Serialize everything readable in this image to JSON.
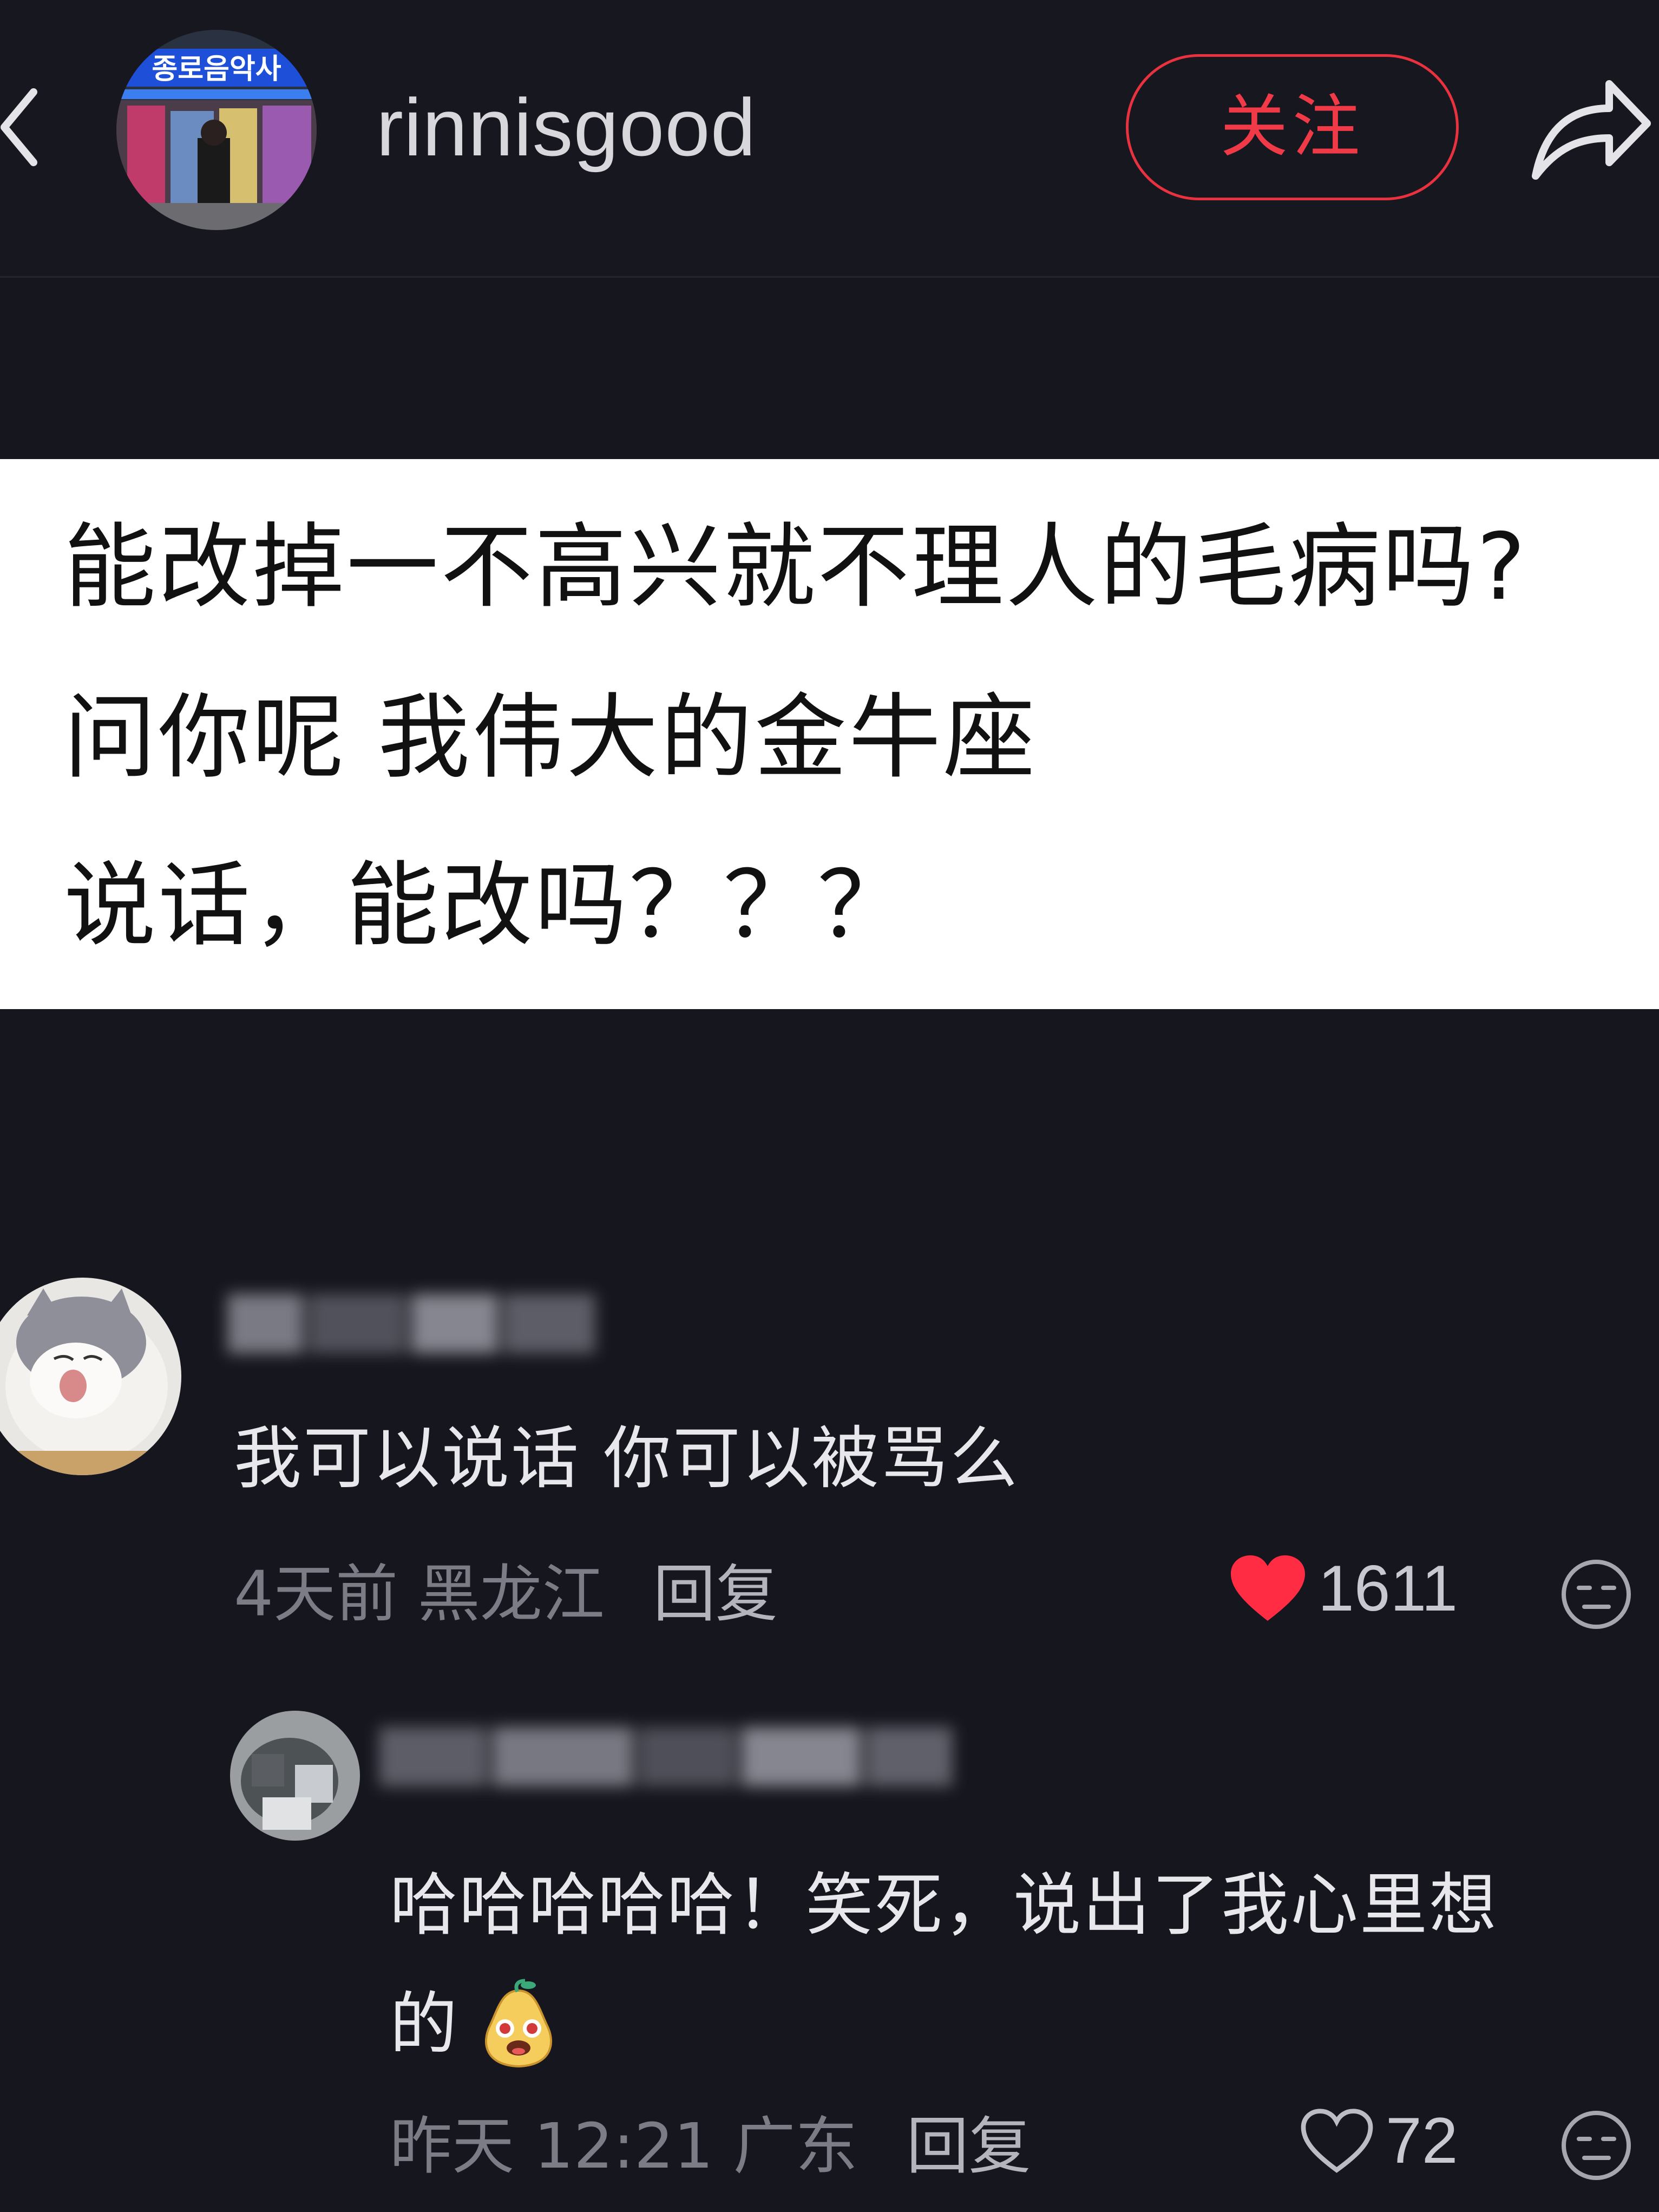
{
  "header": {
    "username": "rinnisgood",
    "follow_label": "关注",
    "avatar_sign_text": "종로음악사"
  },
  "post": {
    "lines": [
      "能改掉一不高兴就不理人的毛病吗?",
      "问你呢 我伟大的金牛座",
      "说话，能改吗？？？"
    ]
  },
  "comments": [
    {
      "text": "我可以说话 你可以被骂么",
      "time": "4天前 黑龙江",
      "reply_label": "回复",
      "likes": "1611",
      "liked": true,
      "like_color": "#ff2c44"
    },
    {
      "text_line1": "哈哈哈哈哈！笑死，说出了我心里想",
      "text_line2": "的",
      "emoji": "pear-face-emoji",
      "time": "昨天 12:21 广东",
      "reply_label": "回复",
      "likes": "72",
      "liked": false
    }
  ],
  "colors": {
    "background": "#16161e",
    "accent": "#f03a48",
    "text": "#e8e8ec",
    "muted": "#7c7c86"
  }
}
